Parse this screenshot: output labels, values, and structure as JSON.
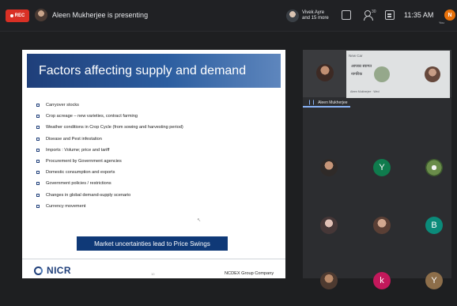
{
  "top_bar": {
    "rec_label": "REC",
    "presenting_text": "Aleen Mukherjee is presenting",
    "participants_line1": "Vivek Ayre",
    "participants_line2": "and 15 more",
    "people_count": "30",
    "clock": "11:35 AM",
    "self_initial": "N",
    "self_label": "You"
  },
  "slide": {
    "title": "Factors affecting supply and demand",
    "bullets": [
      "Carryover stocks",
      "Crop acreage – new varieties, contract farming",
      "Weather conditions in Crop Cycle (from sowing and harvesting period)",
      "Disease and Pest infestation",
      "Imports : Volume; price and tariff",
      "Procurement by Government agencies",
      "Domestic consumption and exports",
      "Government policies / restrictions",
      "Changes in global demand-supply scenario",
      "Currency movement"
    ],
    "banner": "Market uncertainties lead to Price Swings",
    "logo_text": "NICR",
    "page_number": "10",
    "footer_right": "NCDEX Group Company"
  },
  "participants": {
    "main_name": "Aleen Mukherjee",
    "tile_letters": {
      "y1": "Y",
      "b": "B",
      "k": "k",
      "y2": "Y"
    }
  },
  "popup": {
    "header": "New Car",
    "line1": "आपका स्वागत",
    "line2": "नागरिक",
    "footer": "Aleen Mukherjee · Wed"
  },
  "colors": {
    "rec": "#d93025",
    "slide_header": "#1f3f7a",
    "banner": "#0f3977",
    "self_avatar": "#e8710a",
    "speaking": "#8ab4f8"
  }
}
